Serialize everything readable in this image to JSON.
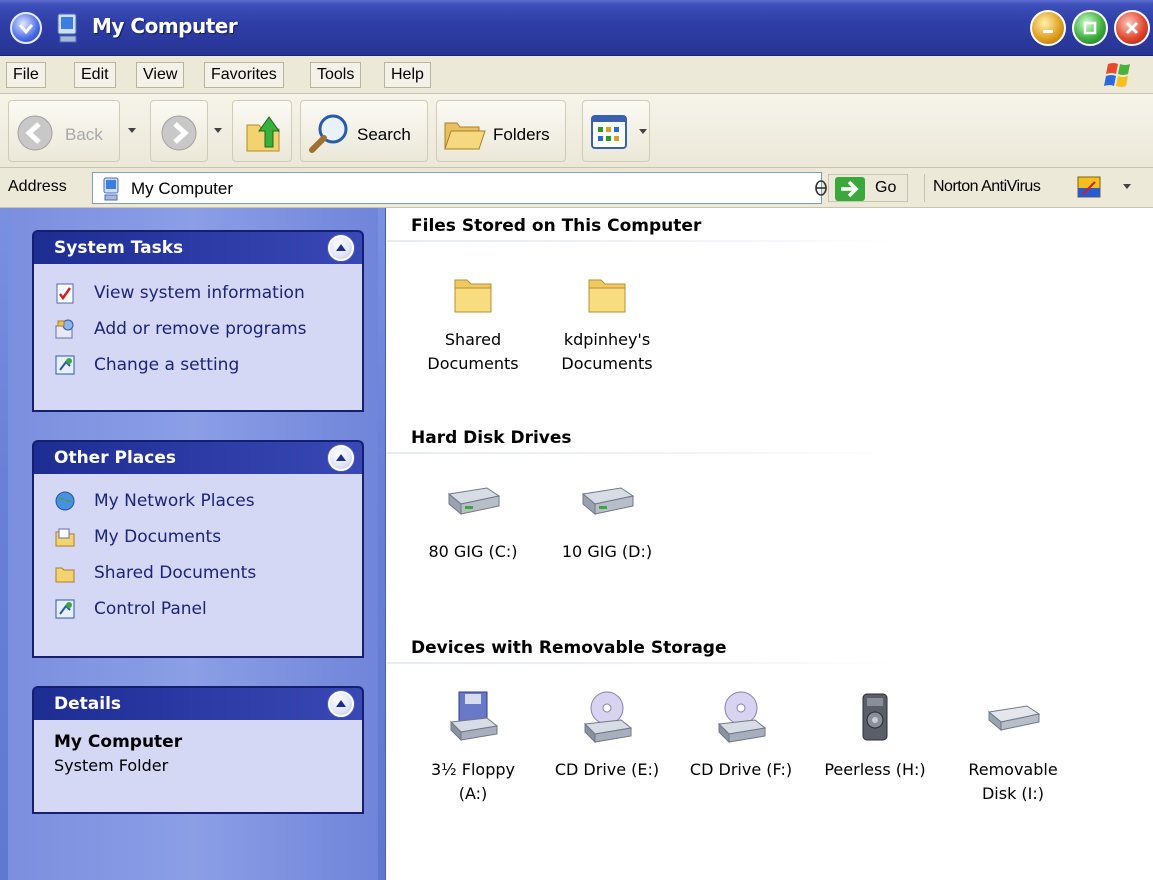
{
  "window": {
    "title": "My Computer"
  },
  "menu": [
    "File",
    "Edit",
    "View",
    "Favorites",
    "Tools",
    "Help"
  ],
  "toolbar": {
    "back_label": "Back",
    "search_label": "Search",
    "folders_label": "Folders"
  },
  "address": {
    "label": "Address",
    "value": "My Computer",
    "go_label": "Go",
    "norton_label": "Norton AntiVirus"
  },
  "task_pane": {
    "system_tasks": {
      "title": "System Tasks",
      "items": [
        "View system information",
        "Add or remove programs",
        "Change a setting"
      ]
    },
    "other_places": {
      "title": "Other Places",
      "items": [
        "My Network Places",
        "My Documents",
        "Shared Documents",
        "Control Panel"
      ]
    },
    "details": {
      "title": "Details",
      "name": "My Computer",
      "type": "System Folder"
    }
  },
  "content": {
    "files_stored": {
      "heading": "Files Stored on This Computer",
      "items": [
        {
          "line1": "Shared",
          "line2": "Documents"
        },
        {
          "line1": "kdpinhey's",
          "line2": "Documents"
        }
      ]
    },
    "hard_disks": {
      "heading": "Hard Disk Drives",
      "items": [
        "80 GIG (C:)",
        "10 GIG (D:)"
      ]
    },
    "removable": {
      "heading": "Devices with Removable Storage",
      "items": [
        {
          "line1": "3½ Floppy",
          "line2": "(A:)"
        },
        {
          "line1": "CD Drive (E:)",
          "line2": ""
        },
        {
          "line1": "CD Drive (F:)",
          "line2": ""
        },
        {
          "line1": "Peerless  (H:)",
          "line2": ""
        },
        {
          "line1": "Removable",
          "line2": "Disk (I:)"
        }
      ]
    }
  },
  "colors": {
    "title_bar": "#2f3fa8",
    "task_pane": "#7b8fdf",
    "panel_header": "#1e2d92",
    "panel_body": "#d4d8f4",
    "link_text": "#1a2478"
  }
}
